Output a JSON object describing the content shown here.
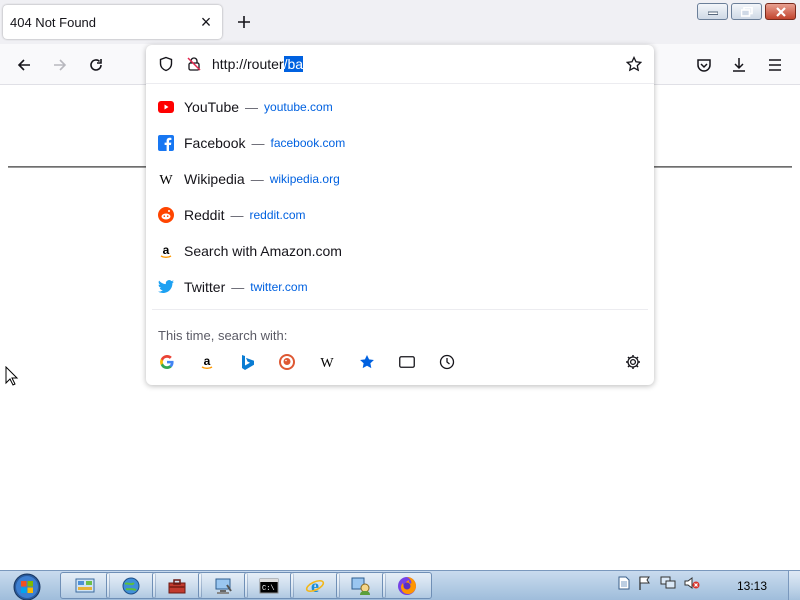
{
  "browser": {
    "tab": {
      "title": "404 Not Found",
      "close_glyph": "×"
    },
    "new_tab_icon": "plus-icon",
    "window_controls": [
      "minimize-icon",
      "maximize-icon",
      "close-icon"
    ],
    "nav": {
      "back_icon": "back-arrow-icon",
      "forward_icon": "forward-arrow-icon",
      "reload_icon": "reload-icon",
      "right_icons": [
        "pocket-icon",
        "download-icon",
        "menu-icon"
      ]
    }
  },
  "urlbar": {
    "url_unselected": "http://router",
    "url_selected": "/ba",
    "left_icons": [
      "shield-icon",
      "insecure-lock-icon"
    ],
    "right_icon": "bookmark-star-icon",
    "selection_color": "#0061e0"
  },
  "suggestions": [
    {
      "title": "YouTube",
      "url": "youtube.com",
      "icon": "youtube-icon"
    },
    {
      "title": "Facebook",
      "url": "facebook.com",
      "icon": "facebook-icon"
    },
    {
      "title": "Wikipedia",
      "url": "wikipedia.org",
      "icon": "wikipedia-icon"
    },
    {
      "title": "Reddit",
      "url": "reddit.com",
      "icon": "reddit-icon"
    },
    {
      "title": "Search with Amazon.com",
      "url": "",
      "icon": "amazon-icon"
    },
    {
      "title": "Twitter",
      "url": "twitter.com",
      "icon": "twitter-icon"
    }
  ],
  "separator_dash": "—",
  "search_with": {
    "label": "This time, search with:",
    "engines": [
      "google-icon",
      "amazon-icon",
      "bing-icon",
      "duckduckgo-icon",
      "wikipedia-icon",
      "bookmarks-icon",
      "tabs-icon",
      "history-icon"
    ],
    "settings_icon": "gear-icon"
  },
  "taskbar": {
    "start_icon": "windows-start-orb-icon",
    "apps": [
      "control-panel-icon",
      "network-globe-icon",
      "toolbox-icon",
      "computer-management-icon",
      "cmd-icon",
      "internet-explorer-icon",
      "user-accounts-icon",
      "firefox-icon"
    ],
    "tray": [
      "document-icon",
      "flag-icon",
      "network-icon",
      "muted-speaker-icon"
    ],
    "clock": "13:13"
  },
  "colors": {
    "accent_blue": "#0061e0",
    "tabstrip_bg": "#f0f0f4",
    "taskbar_top": "#c9dbee"
  }
}
